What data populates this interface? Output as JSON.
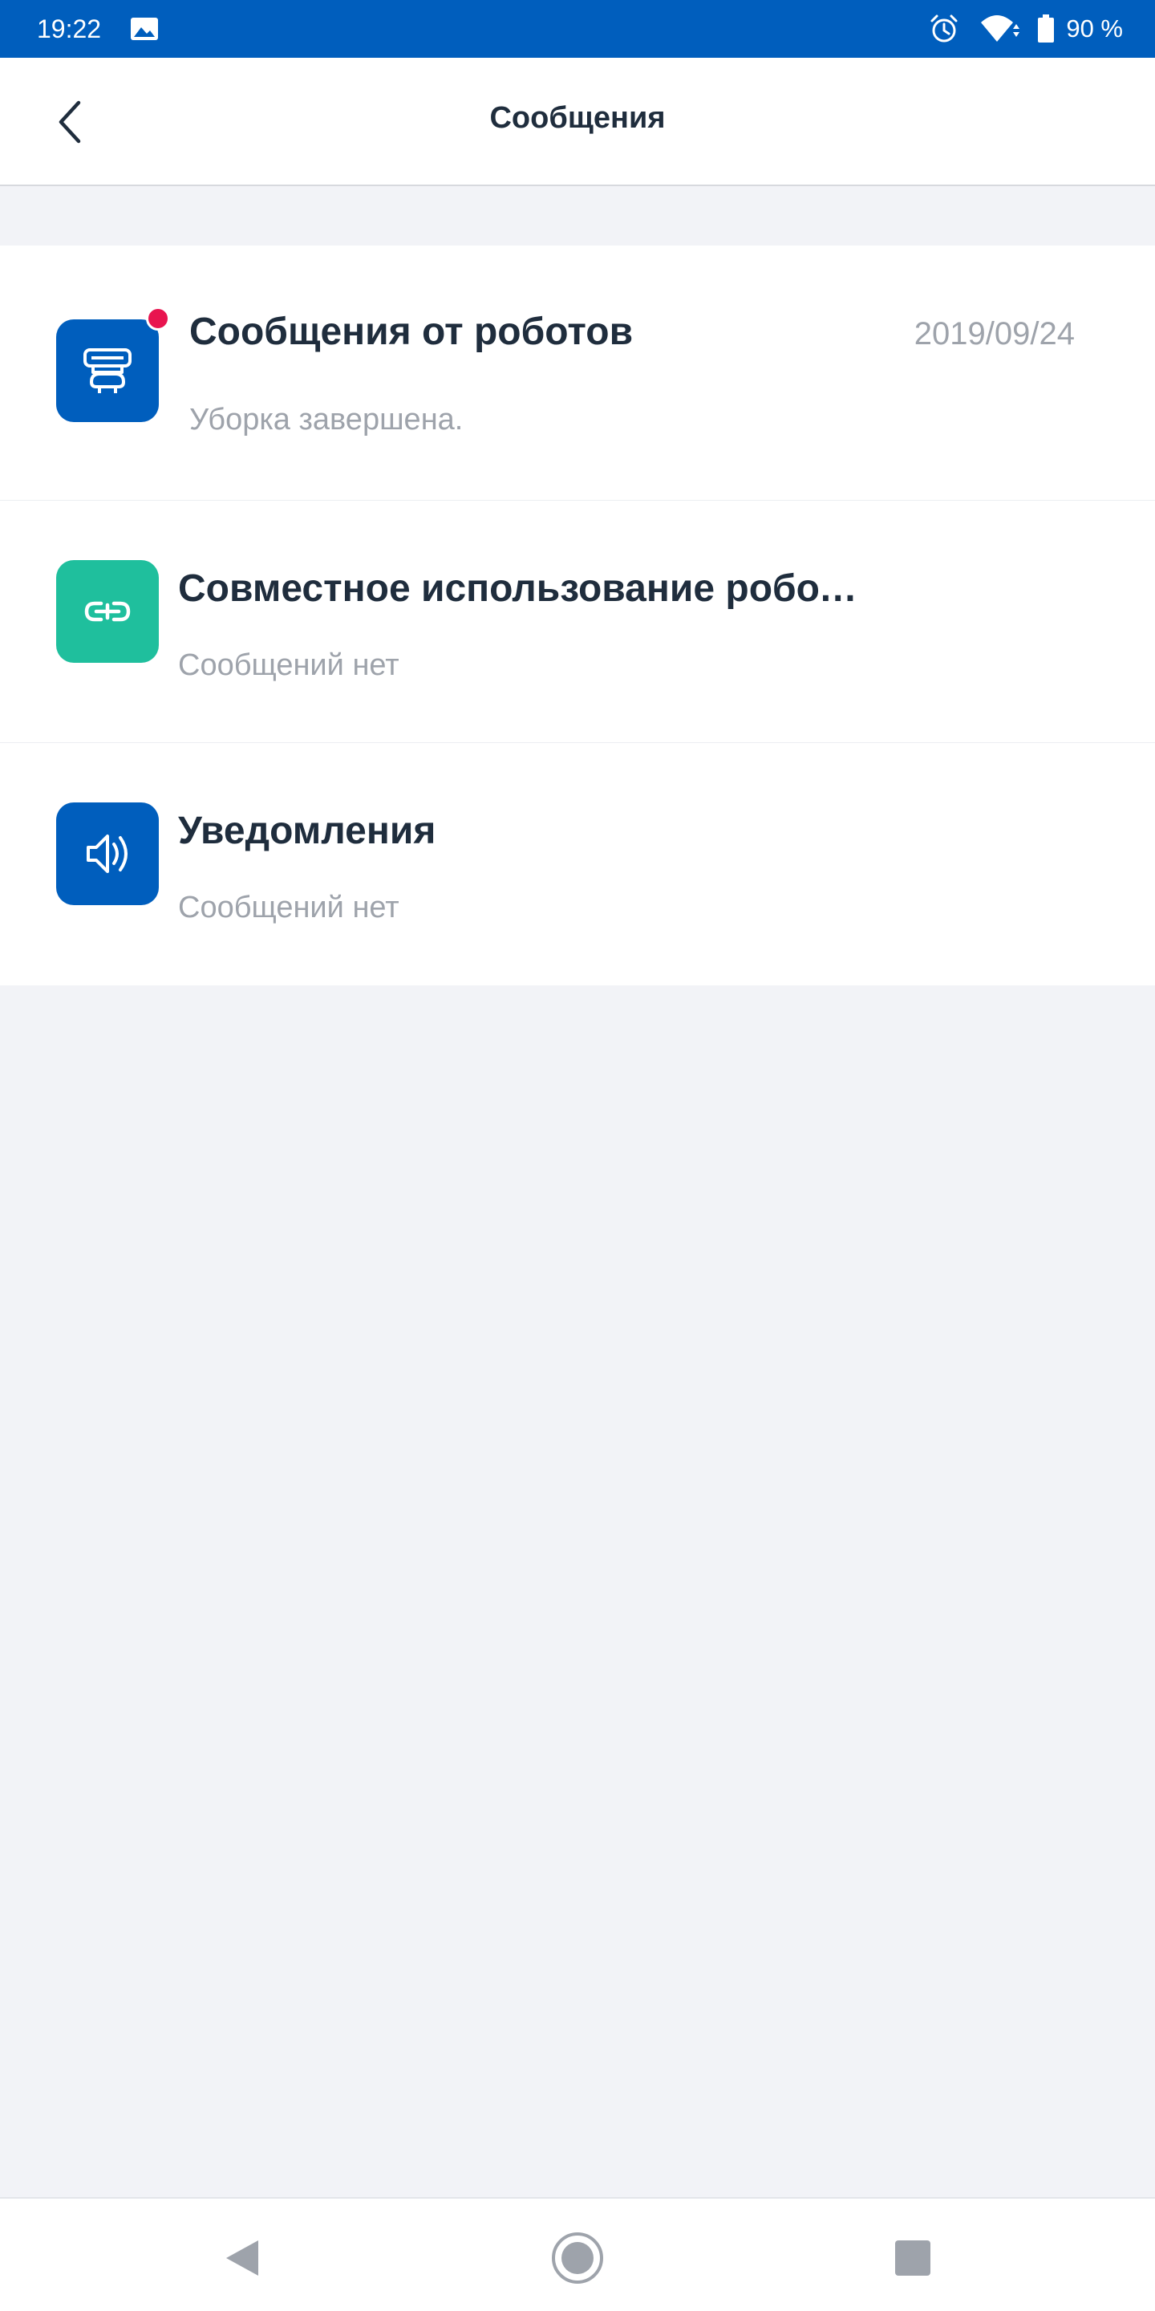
{
  "status_bar": {
    "time": "19:22",
    "battery": "90 %",
    "icons": [
      "gallery-icon",
      "alarm-icon",
      "wifi-icon",
      "battery-icon"
    ]
  },
  "header": {
    "title": "Сообщения",
    "back_icon": "chevron-left-icon"
  },
  "messages": [
    {
      "title": "Сообщения от роботов",
      "subtitle": "Уборка завершена.",
      "date": "2019/09/24",
      "icon": "robot-vacuum-icon",
      "icon_color": "#005ebd",
      "unread": true
    },
    {
      "title": "Совместное использование роботов",
      "subtitle": "Сообщений нет",
      "date": "",
      "icon": "link-icon",
      "icon_color": "#1fbf9d",
      "unread": false
    },
    {
      "title": "Уведомления",
      "subtitle": "Сообщений нет",
      "date": "",
      "icon": "speaker-icon",
      "icon_color": "#005ebd",
      "unread": false
    }
  ],
  "navbar": {
    "icons": [
      "nav-back-icon",
      "nav-home-icon",
      "nav-recent-icon"
    ]
  },
  "colors": {
    "accent": "#005ebd",
    "teal": "#1fbf9d",
    "badge": "#e8144f",
    "background": "#f2f3f7"
  }
}
